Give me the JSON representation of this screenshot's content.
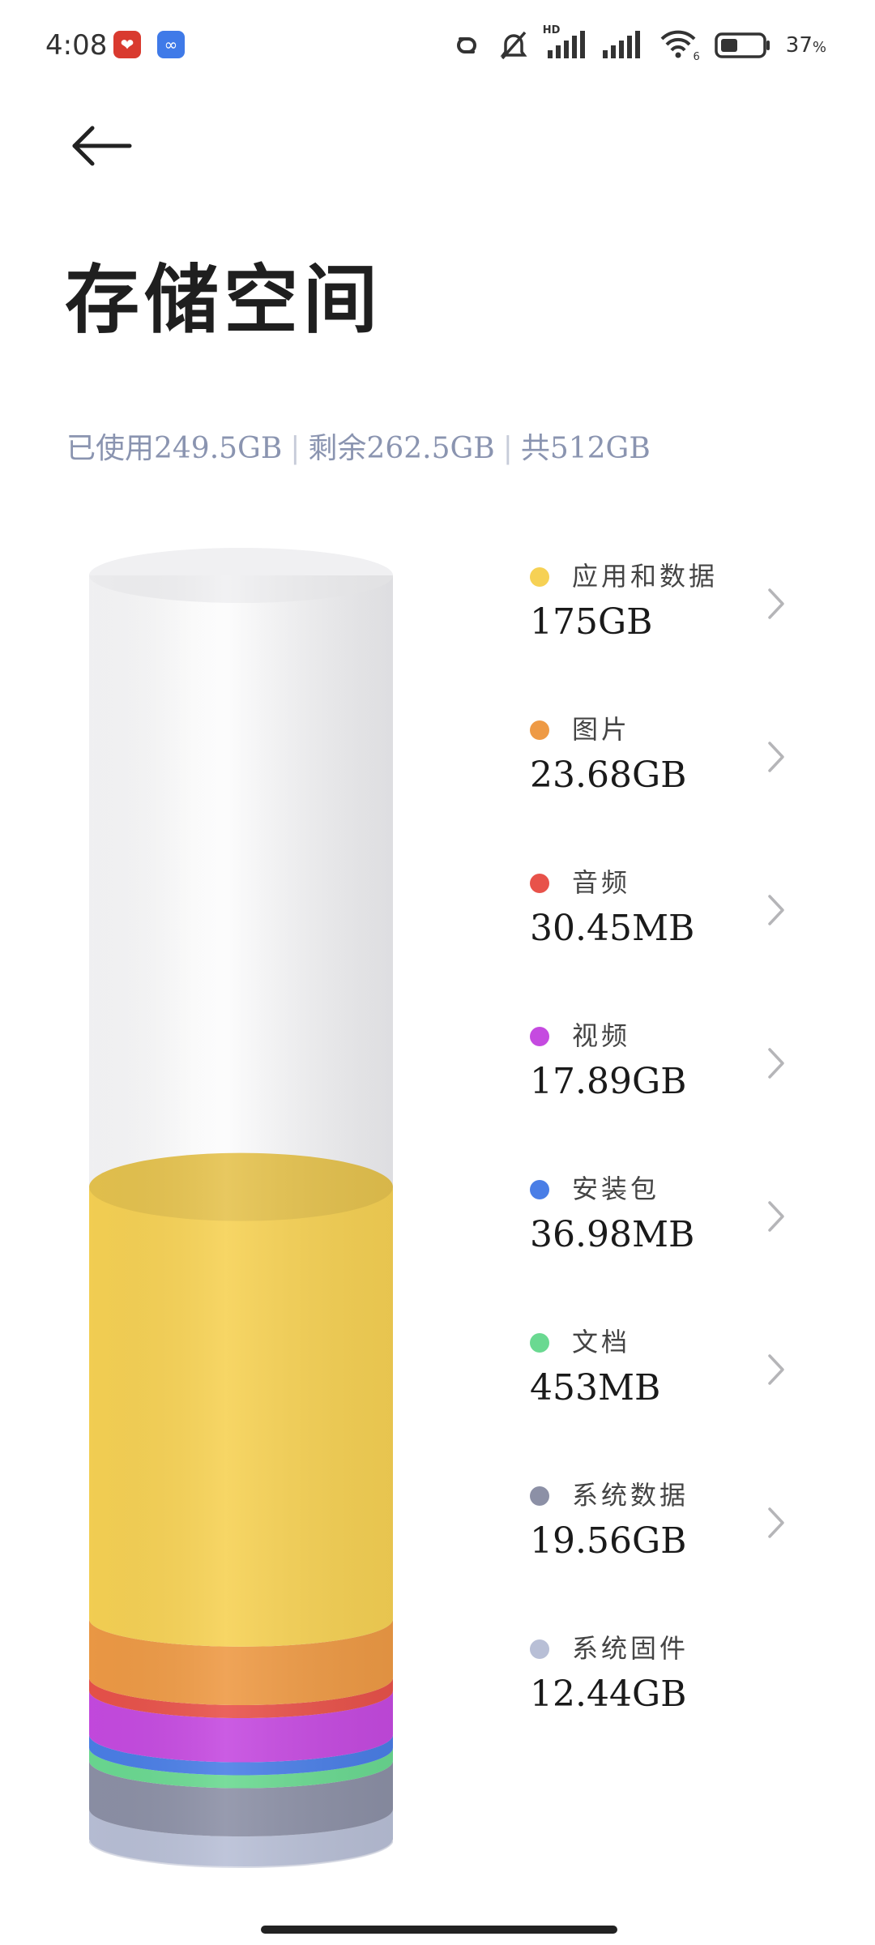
{
  "status_bar": {
    "time": "4:08",
    "battery_percent": "37",
    "battery_unit": "%",
    "network_badge": "HD",
    "wifi_badge": "6",
    "icons": [
      "link-icon",
      "bell-muted-icon",
      "signal-hd-icon",
      "signal-icon",
      "wifi-icon",
      "battery-icon"
    ]
  },
  "header": {
    "title": "存储空间"
  },
  "summary": {
    "used": "已使用249.5GB",
    "remaining": "剩余262.5GB",
    "total": "共512GB",
    "separator": "|"
  },
  "storage_breakdown": {
    "total_gb": 512,
    "used_gb": 249.5,
    "items": [
      {
        "label": "应用和数据",
        "value": "175GB",
        "color": "#f6d154",
        "gb": 175,
        "chevron": true
      },
      {
        "label": "图片",
        "value": "23.68GB",
        "color": "#ee9a45",
        "gb": 23.68,
        "chevron": true
      },
      {
        "label": "音频",
        "value": "30.45MB",
        "color": "#e8524a",
        "gb": 0.03045,
        "chevron": true
      },
      {
        "label": "视频",
        "value": "17.89GB",
        "color": "#c54ae0",
        "gb": 17.89,
        "chevron": true
      },
      {
        "label": "安装包",
        "value": "36.98MB",
        "color": "#4a7ee6",
        "gb": 0.03698,
        "chevron": true
      },
      {
        "label": "文档",
        "value": "453MB",
        "color": "#6ad991",
        "gb": 0.453,
        "chevron": true
      },
      {
        "label": "系统数据",
        "value": "19.56GB",
        "color": "#8c90a6",
        "gb": 19.56,
        "chevron": true
      },
      {
        "label": "系统固件",
        "value": "12.44GB",
        "color": "#b8bfd6",
        "gb": 12.44,
        "chevron": false
      }
    ]
  }
}
